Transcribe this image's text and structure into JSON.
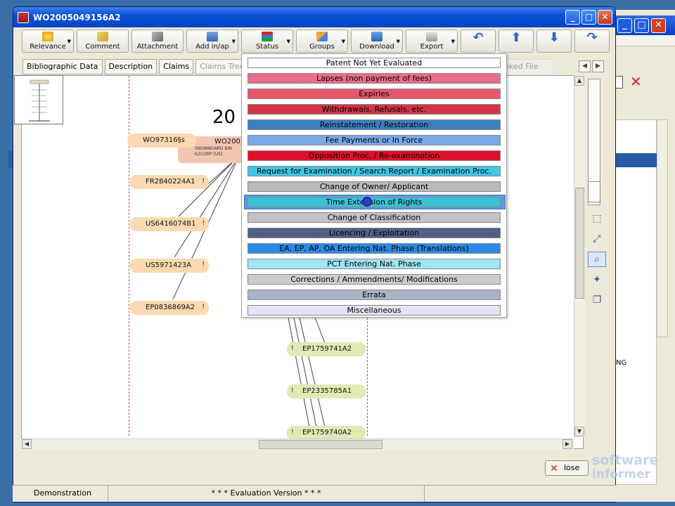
{
  "window": {
    "title": "WO2005049156A2"
  },
  "toolbar": {
    "buttons": [
      {
        "label": "Relevance",
        "icon": "star-icon",
        "dropdown": true
      },
      {
        "label": "Comment",
        "icon": "pencil-icon",
        "dropdown": false
      },
      {
        "label": "Attachment",
        "icon": "paperclip-icon",
        "dropdown": false
      },
      {
        "label": "Add in/ap",
        "icon": "add-user-icon",
        "dropdown": true
      },
      {
        "label": "Status",
        "icon": "status-bars-icon",
        "dropdown": true
      },
      {
        "label": "Groups",
        "icon": "groups-icon",
        "dropdown": true
      },
      {
        "label": "Download",
        "icon": "download-icon",
        "dropdown": true
      },
      {
        "label": "Export",
        "icon": "export-icon",
        "dropdown": true
      }
    ],
    "nav_icons": [
      "undo-arrow-icon",
      "up-arrow-icon",
      "down-arrow-icon",
      "redo-arrow-icon"
    ]
  },
  "tabs": [
    {
      "label": "Bibliographic Data",
      "dim": false
    },
    {
      "label": "Description",
      "dim": false
    },
    {
      "label": "Claims",
      "dim": false
    },
    {
      "label": "Claims Tree",
      "dim": true
    },
    {
      "label": "nked File",
      "dim": true
    }
  ],
  "diagram": {
    "year_fragment": "20",
    "center_node": {
      "label": "WO200",
      "sub1": "SNOWBOARD BIN",
      "sub2": "K2CORP [US]"
    },
    "left_nodes": [
      "WO97316§s",
      "FR2840224A1",
      "US6416074B1",
      "US5971423A",
      "EP0836869A2"
    ],
    "right_nodes": [
      "EP1759741A2",
      "EP2335785A1",
      "EP1759740A2"
    ],
    "marker": "!"
  },
  "status_menu": {
    "items": [
      {
        "label": "Patent Not Yet Evaluated",
        "color": "#ffffff"
      },
      {
        "label": "Lapses (non payment of fees)",
        "color": "#ea6d8a"
      },
      {
        "label": "Expiries",
        "color": "#e8566e"
      },
      {
        "label": "Withdrawals, Refusals, etc.",
        "color": "#d2354a"
      },
      {
        "label": "Reinstatement / Restoration",
        "color": "#3b7fc0"
      },
      {
        "label": "Fee Payments or In Force",
        "color": "#79a8e8"
      },
      {
        "label": "Opposition Proc. / Re-examination",
        "color": "#e0102a"
      },
      {
        "label": "Request for Examination / Search Report / Examination Proc.",
        "color": "#40c6e4"
      },
      {
        "label": "Change of Owner/ Applicant",
        "color": "#b9b9b9"
      },
      {
        "label": "Time Extension of Rights",
        "color": "#38c2d6"
      },
      {
        "label": "Change of Classification",
        "color": "#c6bfc6"
      },
      {
        "label": "Licencing / Exploitation",
        "color": "#4f5f86"
      },
      {
        "label": "EA, EP, AP, OA Entering Nat. Phase (Translations)",
        "color": "#2a8ae6"
      },
      {
        "label": "PCT Entering Nat. Phase",
        "color": "#9fe6f2"
      },
      {
        "label": "Corrections / Ammendments/ Modifications",
        "color": "#cccccc"
      },
      {
        "label": "Errata",
        "color": "#aab4c8"
      },
      {
        "label": "Miscellaneous",
        "color": "#e4e2f4"
      }
    ],
    "highlighted_index": 9
  },
  "side_tools": [
    "fit-page-icon",
    "expand-icon",
    "zoom-icon",
    "magic-wand-icon",
    "copy-icon"
  ],
  "close_button": {
    "label": "lose"
  },
  "watermark": {
    "line1": "software",
    "line2": "informer"
  },
  "status_bar": {
    "left": "Demonstration",
    "center": "* * * Evaluation Version * * *"
  }
}
